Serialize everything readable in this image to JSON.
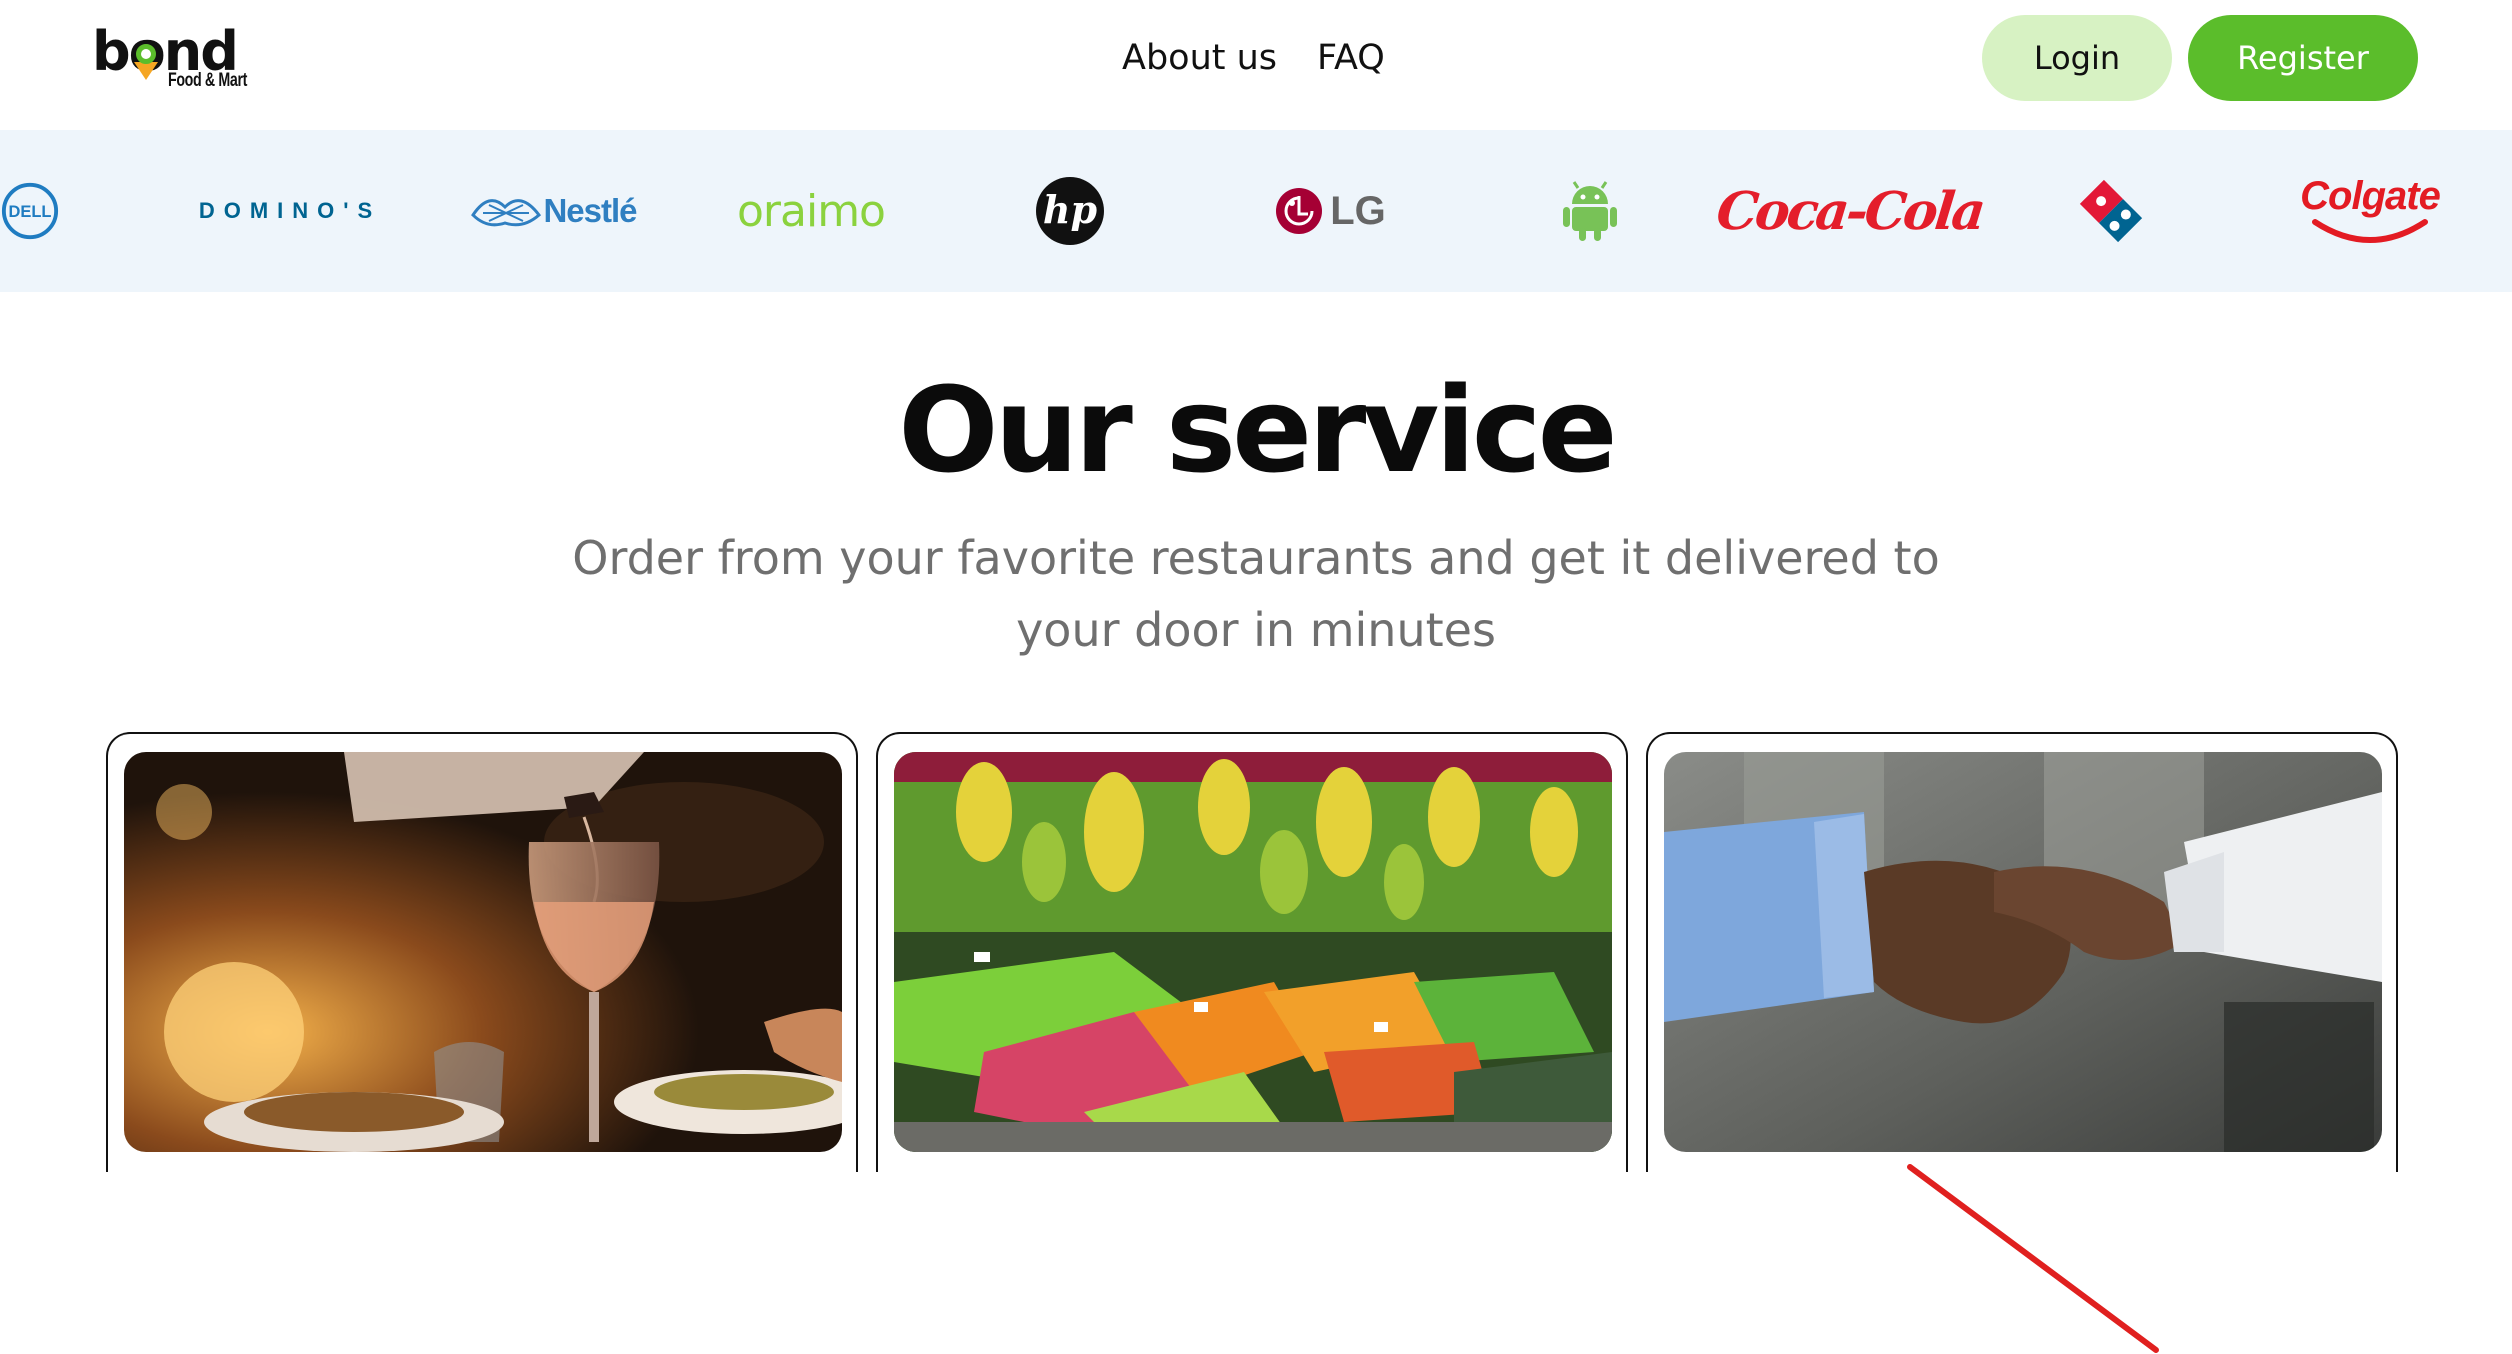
{
  "logo": {
    "wordmark": "bond",
    "tagline": "Food & Mart"
  },
  "nav": {
    "items": [
      {
        "label": "About us"
      },
      {
        "label": "FAQ"
      }
    ]
  },
  "auth": {
    "login_label": "Login",
    "register_label": "Register"
  },
  "brands": [
    {
      "name": "DELL",
      "color": "#1f7cc1"
    },
    {
      "name": "DOMINO'S",
      "color": "#006491"
    },
    {
      "name": "Nestlé",
      "color": "#2f7fc1"
    },
    {
      "name": "oraimo",
      "color": "#8bd23e"
    },
    {
      "name": "hp",
      "color": "#111111"
    },
    {
      "name": "LG",
      "color": "#a50034"
    },
    {
      "name": "android",
      "color": "#78c257"
    },
    {
      "name": "Coca-Cola",
      "color": "#e41e2b"
    },
    {
      "name": "domino-tile",
      "color": "#006491"
    },
    {
      "name": "Colgate",
      "color": "#e31b23"
    }
  ],
  "service": {
    "title": "Our service",
    "subtitle": "Order from your favorite restaurants and get it delivered to your door in minutes",
    "cards": [
      {
        "image": "restaurant-dining-photo"
      },
      {
        "image": "fruit-market-photo"
      },
      {
        "image": "handshake-photo"
      }
    ]
  },
  "colors": {
    "brand_green": "#5bbd2b",
    "login_bg": "#d7f2c3",
    "strip_bg": "#eef5fb",
    "annotation_red": "#e0201f"
  }
}
